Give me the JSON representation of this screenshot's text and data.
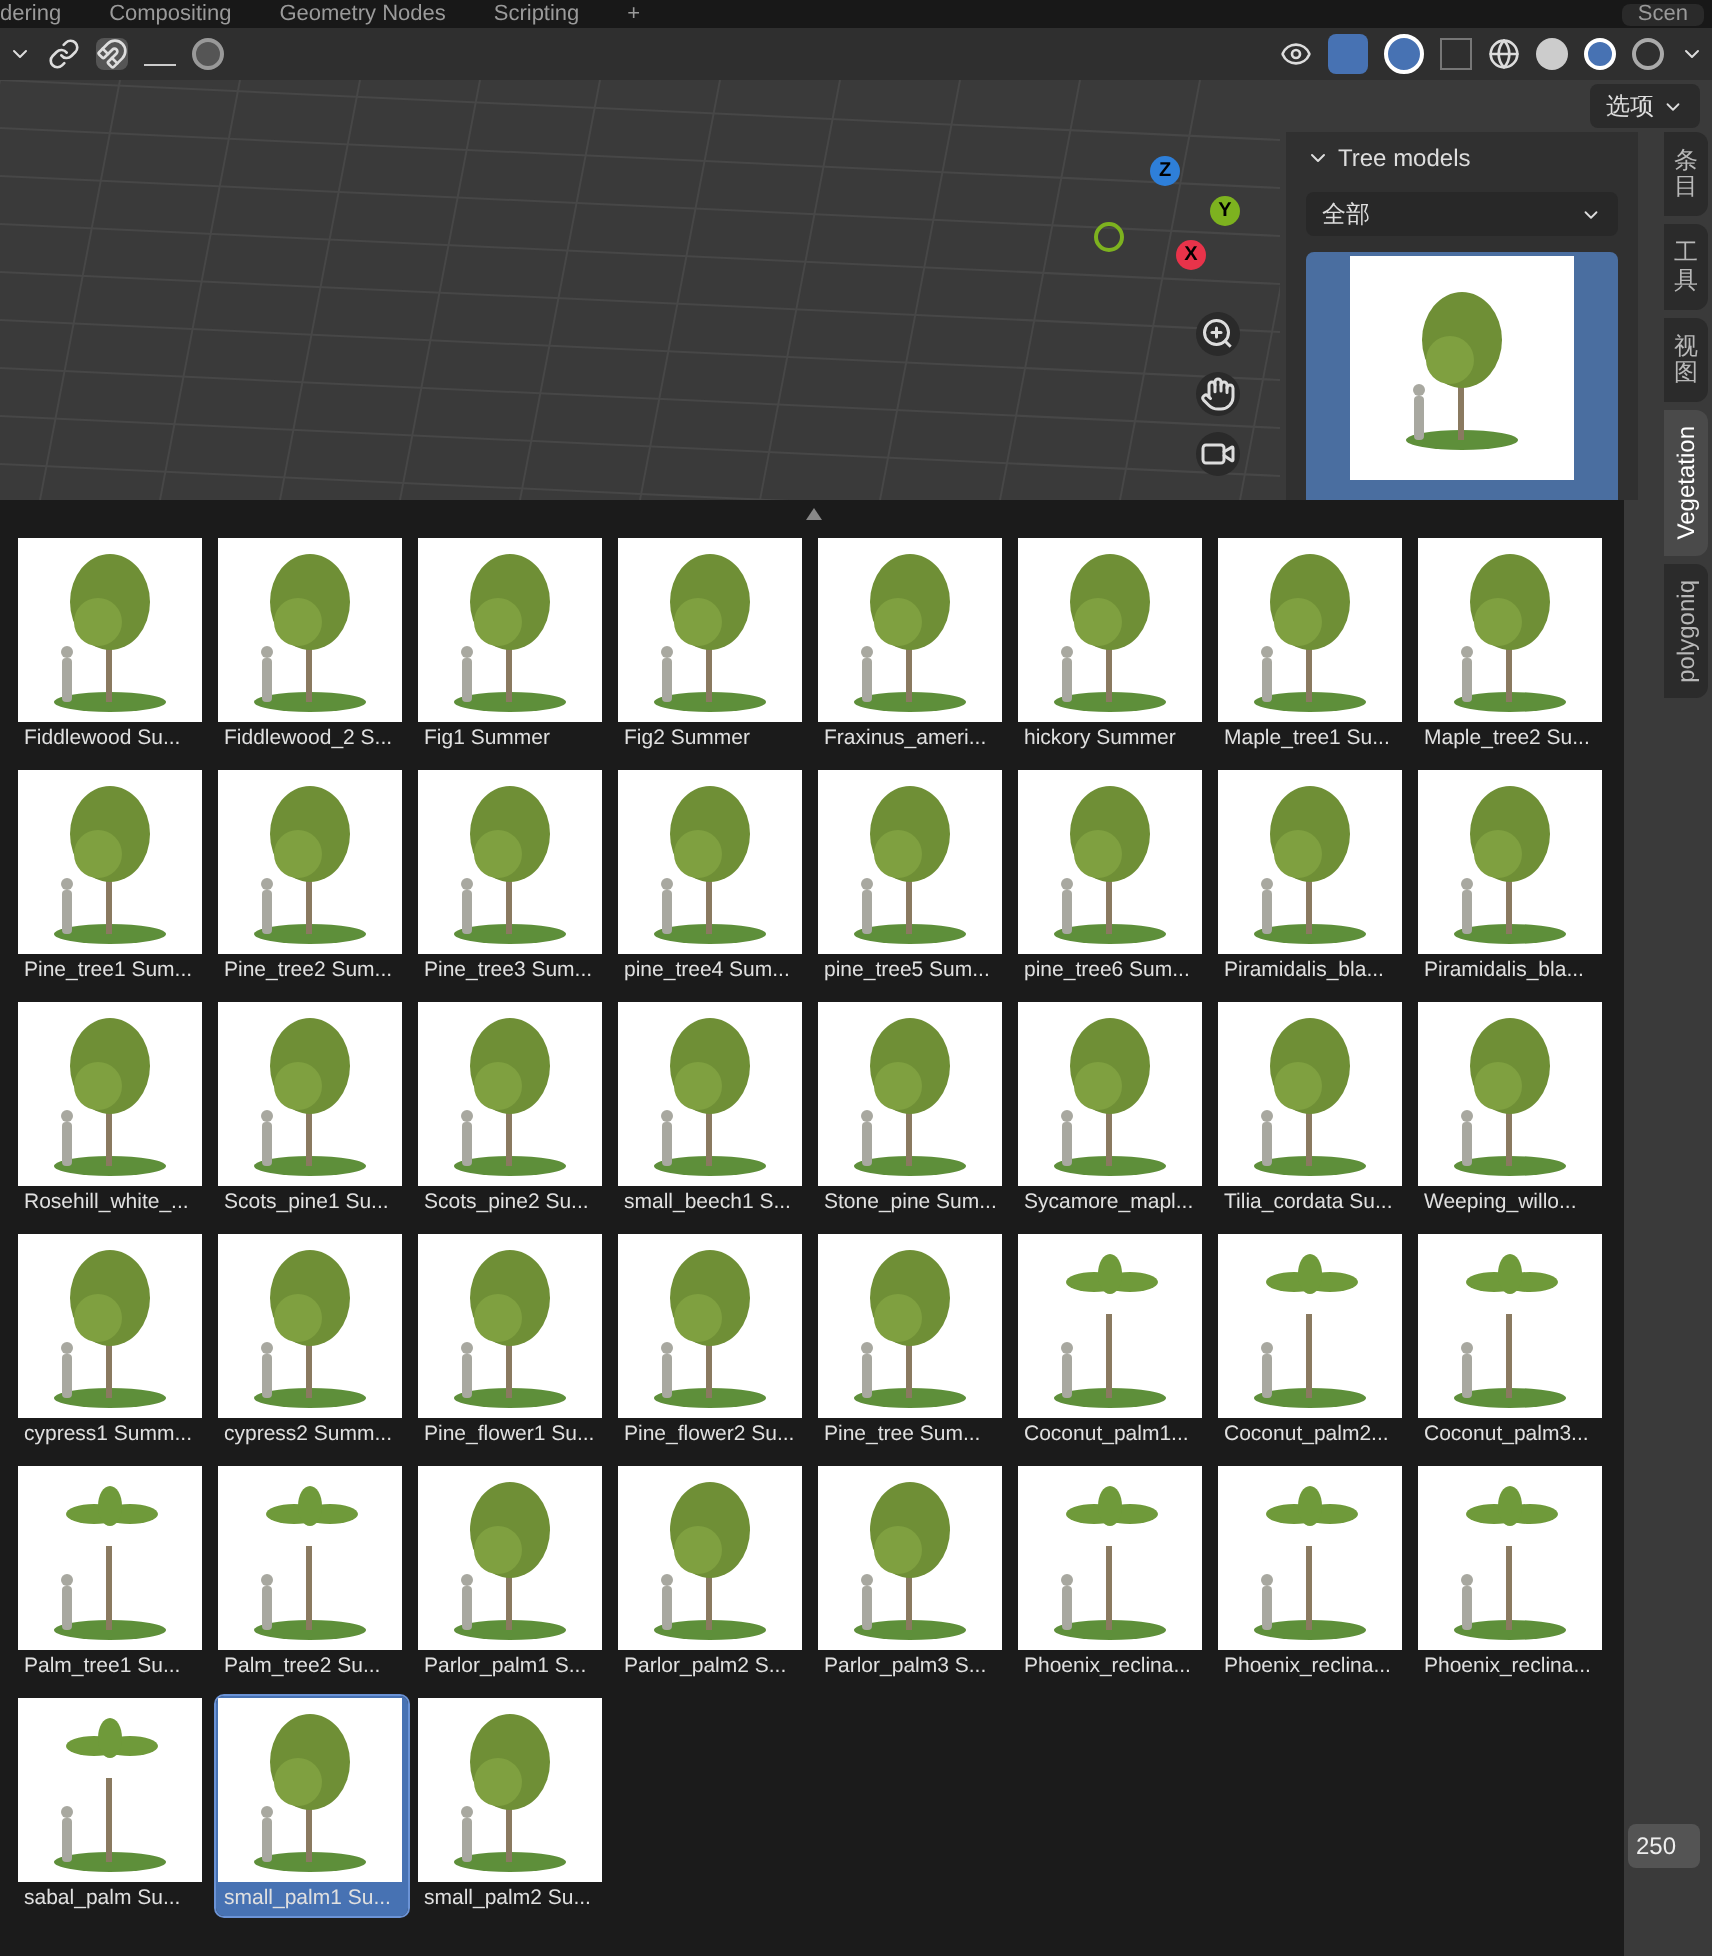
{
  "top_tabs": [
    "dering",
    "Compositing",
    "Geometry Nodes",
    "Scripting",
    "+"
  ],
  "scene_field": "Scen",
  "options_button": "选项",
  "gizmo_axes": [
    "Z",
    "Y",
    "X"
  ],
  "panel": {
    "title": "Tree models",
    "expanded": true,
    "category": "全部"
  },
  "side_tabs": [
    {
      "label": "条目",
      "kind": "cjk",
      "selected": false
    },
    {
      "label": "工具",
      "kind": "cjk",
      "selected": false
    },
    {
      "label": "视图",
      "kind": "cjk",
      "selected": false
    },
    {
      "label": "Vegetation",
      "kind": "latin",
      "selected": true
    },
    {
      "label": "polygoniq",
      "kind": "latin",
      "selected": false
    }
  ],
  "browser": {
    "items": [
      {
        "label": "Fiddlewood Su...",
        "selected": false
      },
      {
        "label": "Fiddlewood_2 S...",
        "selected": false
      },
      {
        "label": "Fig1 Summer",
        "selected": false
      },
      {
        "label": "Fig2 Summer",
        "selected": false
      },
      {
        "label": "Fraxinus_ameri...",
        "selected": false
      },
      {
        "label": "hickory Summer",
        "selected": false
      },
      {
        "label": "Maple_tree1 Su...",
        "selected": false
      },
      {
        "label": "Maple_tree2 Su...",
        "selected": false
      },
      {
        "label": "Pine_tree1 Sum...",
        "selected": false
      },
      {
        "label": "Pine_tree2 Sum...",
        "selected": false
      },
      {
        "label": "Pine_tree3 Sum...",
        "selected": false
      },
      {
        "label": "pine_tree4 Sum...",
        "selected": false
      },
      {
        "label": "pine_tree5 Sum...",
        "selected": false
      },
      {
        "label": "pine_tree6 Sum...",
        "selected": false
      },
      {
        "label": "Piramidalis_bla...",
        "selected": false
      },
      {
        "label": "Piramidalis_bla...",
        "selected": false
      },
      {
        "label": "Rosehill_white_...",
        "selected": false
      },
      {
        "label": "Scots_pine1 Su...",
        "selected": false
      },
      {
        "label": "Scots_pine2 Su...",
        "selected": false
      },
      {
        "label": "small_beech1 S...",
        "selected": false
      },
      {
        "label": "Stone_pine Sum...",
        "selected": false
      },
      {
        "label": "Sycamore_mapl...",
        "selected": false
      },
      {
        "label": "Tilia_cordata Su...",
        "selected": false
      },
      {
        "label": "Weeping_willo...",
        "selected": false
      },
      {
        "label": "cypress1 Summ...",
        "selected": false
      },
      {
        "label": "cypress2 Summ...",
        "selected": false
      },
      {
        "label": "Pine_flower1 Su...",
        "selected": false
      },
      {
        "label": "Pine_flower2 Su...",
        "selected": false
      },
      {
        "label": "Pine_tree Sum...",
        "selected": false
      },
      {
        "label": "Coconut_palm1...",
        "selected": false
      },
      {
        "label": "Coconut_palm2...",
        "selected": false
      },
      {
        "label": "Coconut_palm3...",
        "selected": false
      },
      {
        "label": "Palm_tree1 Su...",
        "selected": false
      },
      {
        "label": "Palm_tree2 Su...",
        "selected": false
      },
      {
        "label": "Parlor_palm1 S...",
        "selected": false
      },
      {
        "label": "Parlor_palm2 S...",
        "selected": false
      },
      {
        "label": "Parlor_palm3 S...",
        "selected": false
      },
      {
        "label": "Phoenix_reclina...",
        "selected": false
      },
      {
        "label": "Phoenix_reclina...",
        "selected": false
      },
      {
        "label": "Phoenix_reclina...",
        "selected": false
      },
      {
        "label": "sabal_palm Su...",
        "selected": false
      },
      {
        "label": "small_palm1 Su...",
        "selected": true
      },
      {
        "label": "small_palm2 Su...",
        "selected": false
      }
    ]
  },
  "frame_field": "250"
}
